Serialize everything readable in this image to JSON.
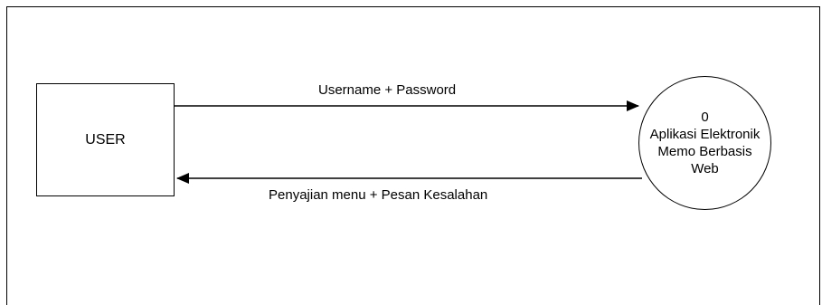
{
  "diagram": {
    "entity": {
      "label": "USER"
    },
    "process": {
      "number": "0",
      "lines": [
        "Aplikasi Elektronik",
        "Memo Berbasis",
        "Web"
      ]
    },
    "flows": [
      {
        "label": "Username + Password",
        "from": "USER",
        "to": "Aplikasi Elektronik Memo Berbasis Web"
      },
      {
        "label": "Penyajian menu  +  Pesan Kesalahan",
        "from": "Aplikasi Elektronik Memo Berbasis Web",
        "to": "USER"
      }
    ]
  }
}
